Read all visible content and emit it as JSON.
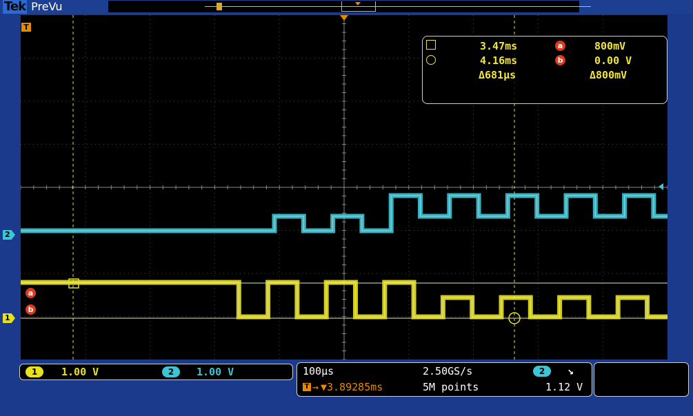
{
  "header": {
    "brand": "Tek",
    "mode": "PreVu"
  },
  "markers": {
    "trigger": "T",
    "ch2": "2",
    "ch1": "1",
    "cursor_a": "a",
    "cursor_b": "b"
  },
  "readout": {
    "row1": {
      "time": "3.47ms",
      "cursor": "a",
      "volt": "800mV"
    },
    "row2": {
      "time": "4.16ms",
      "cursor": "b",
      "volt": "0.00 V"
    },
    "row3": {
      "delta_time": "Δ681μs",
      "delta_volt": "Δ800mV"
    }
  },
  "channels": {
    "ch1": {
      "badge": "1",
      "scale": "1.00 V",
      "color": "#e8e21e"
    },
    "ch2": {
      "badge": "2",
      "scale": "1.00 V",
      "color": "#3cc5d6"
    }
  },
  "horizontal": {
    "time_div": "100μs",
    "sample_rate": "2.50GS/s",
    "trigger_channel": "2",
    "trigger_slope": "falling-edge-icon",
    "trigger_slope_glyph": "↘",
    "trigger_icon": "T",
    "trigger_position": "▼3.89285ms",
    "record_length": "5M points",
    "trigger_level": "1.12 V"
  },
  "colors": {
    "trigger": "#e68a00",
    "ch1": "#e8e21e",
    "ch2": "#3cc5d6",
    "cursor": "#e03a1c",
    "bezel": "#1b3a8c"
  },
  "waveforms": {
    "ch2_pattern": [
      0,
      0,
      0,
      0,
      1,
      0,
      1,
      0,
      2,
      1,
      2,
      1,
      2,
      1,
      2,
      1,
      2,
      1,
      2,
      1
    ],
    "ch1_pattern": [
      2,
      2,
      2,
      2,
      2,
      0,
      2,
      0,
      2,
      0,
      2,
      0,
      1,
      0,
      1,
      0,
      1,
      0,
      1,
      0
    ]
  }
}
